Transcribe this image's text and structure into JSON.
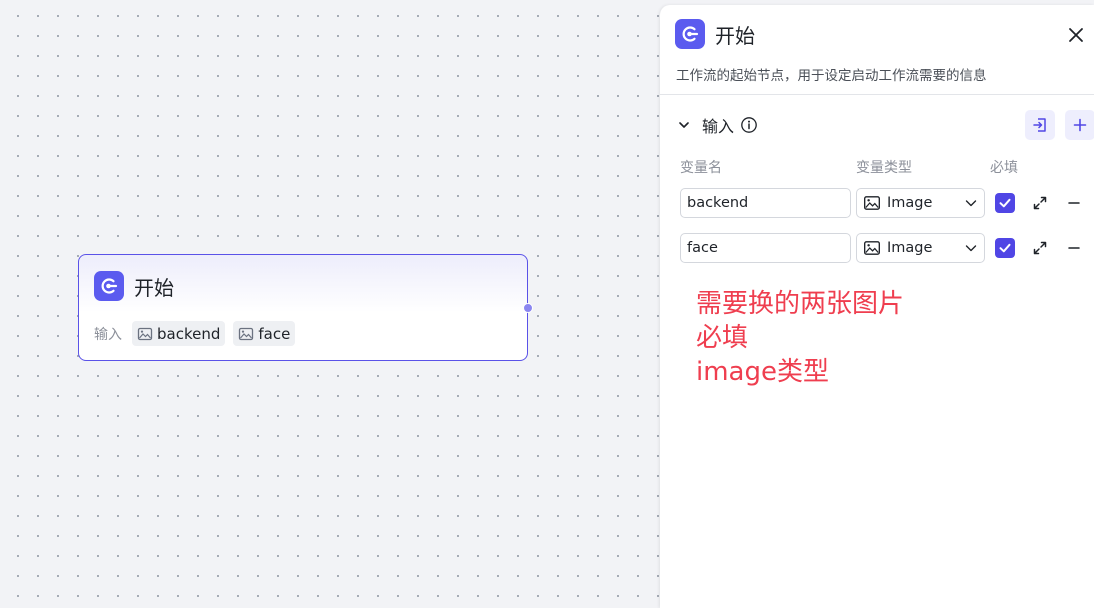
{
  "node": {
    "title": "开始",
    "inputs_label": "输入",
    "tags": [
      "backend",
      "face"
    ]
  },
  "panel": {
    "title": "开始",
    "description": "工作流的起始节点，用于设定启动工作流需要的信息",
    "section_title": "输入",
    "columns": {
      "name": "变量名",
      "type": "变量类型",
      "required": "必填"
    },
    "rows": [
      {
        "name": "backend",
        "type": "Image",
        "required": true
      },
      {
        "name": "face",
        "type": "Image",
        "required": true
      }
    ]
  },
  "annotation": {
    "lines": [
      "需要换的两张图片",
      "必填",
      "image类型"
    ]
  },
  "colors": {
    "accent": "#5046e5",
    "node_border": "#5a52e8",
    "annotation": "#ef3e4f",
    "icon_bg": "#5b5bef"
  },
  "icons": {
    "app": "start-node-icon",
    "close": "close-icon",
    "chevron": "chevron-down-icon",
    "info": "info-icon",
    "import": "import-icon",
    "add": "plus-icon",
    "image": "image-icon",
    "expand": "expand-icon",
    "remove": "minus-icon",
    "check": "check-icon"
  }
}
